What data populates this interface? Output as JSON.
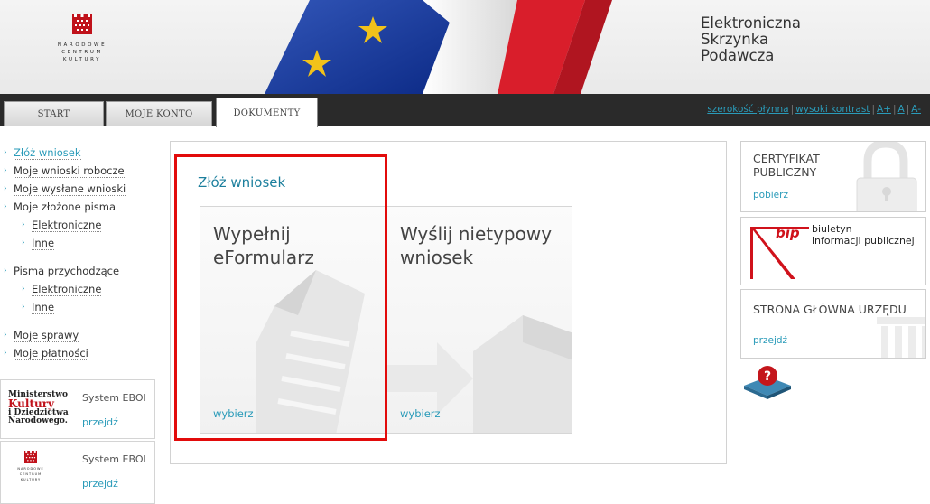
{
  "header": {
    "logo_text": "NARODOWE\nCENTRUM\nKULTURY",
    "site_title": [
      "Elektroniczna",
      "Skrzynka",
      "Podawcza"
    ]
  },
  "nav": {
    "tabs": [
      {
        "label": "START"
      },
      {
        "label": "MOJE KONTO"
      },
      {
        "label": "DOKUMENTY",
        "active": true
      }
    ],
    "utility": [
      "szerokość płynna",
      "wysoki kontrast",
      "A+",
      "A",
      "A-"
    ]
  },
  "sidebar": {
    "items": [
      {
        "label": "Złóż wniosek",
        "active": true
      },
      {
        "label": "Moje wnioski robocze"
      },
      {
        "label": "Moje wysłane wnioski"
      },
      {
        "label": "Moje złożone pisma"
      },
      {
        "label": "Elektroniczne",
        "sub": true
      },
      {
        "label": "Inne",
        "sub": true
      },
      {
        "label": "Pisma przychodzące"
      },
      {
        "label": "Elektroniczne",
        "sub": true
      },
      {
        "label": "Inne",
        "sub": true
      },
      {
        "label": "Moje sprawy"
      },
      {
        "label": "Moje płatności"
      }
    ],
    "boxes": [
      {
        "logo_lines": [
          "Ministerstwo",
          "Kultury",
          "i Dziedzictwa",
          "Narodowego."
        ],
        "title": "System EBOI",
        "link": "przejdź"
      },
      {
        "logo_text": "NARODOWE\nCENTRUM\nKULTURY",
        "title": "System EBOI",
        "link": "przejdź"
      }
    ]
  },
  "main": {
    "section_title": "Złóż wniosek",
    "tiles": [
      {
        "title": "Wypełnij\neFormularz",
        "link": "wybierz"
      },
      {
        "title": "Wyślij nietypowy\nwniosek",
        "link": "wybierz"
      }
    ]
  },
  "right": {
    "cert": {
      "title": "CERTYFIKAT\nPUBLICZNY",
      "link": "pobierz"
    },
    "bip": {
      "word": "bip",
      "text": "biuletyn\ninformacji publicznej"
    },
    "home": {
      "title": "STRONA GŁÓWNA URZĘDU",
      "link": "przejdź"
    }
  },
  "colors": {
    "accent": "#2a9bb9",
    "nav_bg": "#2a2a2a",
    "highlight": "#e20b0b",
    "brand_red": "#c0121b"
  },
  "icons": [
    "nck-logo-icon",
    "flag-banner",
    "document-icon",
    "arrow-box-icon",
    "padlock-icon",
    "bip-logo-icon",
    "help-icon"
  ]
}
